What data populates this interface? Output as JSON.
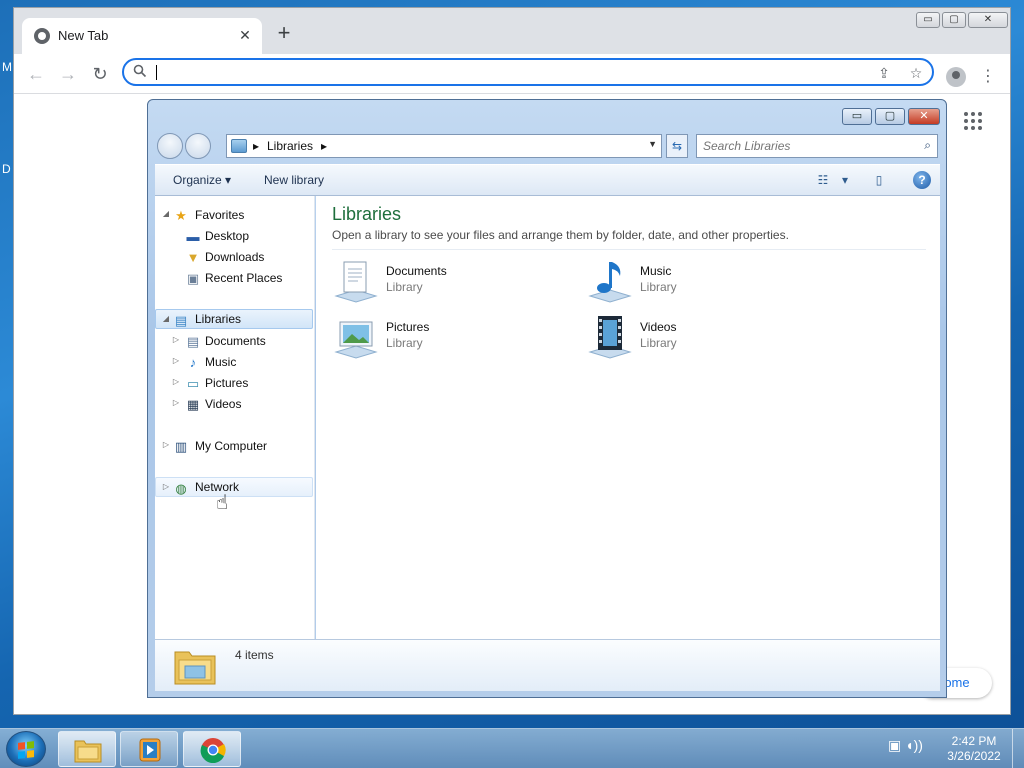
{
  "desktop": {
    "edge_glyphs": [
      "M",
      "D"
    ]
  },
  "chrome": {
    "tab_title": "New Tab",
    "tab_close_glyph": "✕",
    "new_tab_glyph": "+",
    "win_buttons": [
      "▭",
      "▢",
      "✕"
    ],
    "back_glyph": "←",
    "forward_glyph": "→",
    "reload_glyph": "↻",
    "address_value": "",
    "address_placeholder": "",
    "share_glyph": "⇪",
    "star_glyph": "☆",
    "menu_glyph": "⋮",
    "customize_label": "rome"
  },
  "explorer": {
    "win_buttons": [
      "▭",
      "▢",
      "✕"
    ],
    "breadcrumb": [
      "Libraries"
    ],
    "crumb_sep": "▸",
    "address_dropdown_glyph": "▼",
    "refresh_glyph": "⇆",
    "search_placeholder": "Search Libraries",
    "search_glyph": "⌕",
    "toolbar": {
      "organize_label": "Organize",
      "organize_caret": "▾",
      "new_library_label": "New library",
      "view_glyph": "☷",
      "view_caret": "▾",
      "preview_glyph": "▯",
      "help_glyph": "?"
    },
    "nav": {
      "expander_open": "◢",
      "expander_closed": "▷",
      "favorites": {
        "label": "Favorites",
        "icon": "★",
        "items": [
          {
            "label": "Desktop",
            "icon": "▬"
          },
          {
            "label": "Downloads",
            "icon": "▼"
          },
          {
            "label": "Recent Places",
            "icon": "▣"
          }
        ]
      },
      "libraries": {
        "label": "Libraries",
        "icon": "▤",
        "items": [
          {
            "label": "Documents",
            "icon": "▤"
          },
          {
            "label": "Music",
            "icon": "♪"
          },
          {
            "label": "Pictures",
            "icon": "▭"
          },
          {
            "label": "Videos",
            "icon": "▦"
          }
        ]
      },
      "computer": {
        "label": "My Computer",
        "icon": "▥"
      },
      "network": {
        "label": "Network",
        "icon": "◍"
      }
    },
    "content": {
      "heading": "Libraries",
      "description": "Open a library to see your files and arrange them by folder, date, and other properties.",
      "libraries": [
        {
          "name": "Documents",
          "type": "Library"
        },
        {
          "name": "Music",
          "type": "Library"
        },
        {
          "name": "Pictures",
          "type": "Library"
        },
        {
          "name": "Videos",
          "type": "Library"
        }
      ]
    },
    "details": {
      "item_count": "4 items"
    }
  },
  "cursor_glyph": "☝",
  "taskbar": {
    "tray_glyphs": "▣ ◖))",
    "time": "2:42 PM",
    "date": "3/26/2022"
  },
  "colors": {
    "heading_green": "#1e6e3c",
    "selection_blue": "#d2e5f8",
    "omnibox_focus": "#1a73e8"
  }
}
